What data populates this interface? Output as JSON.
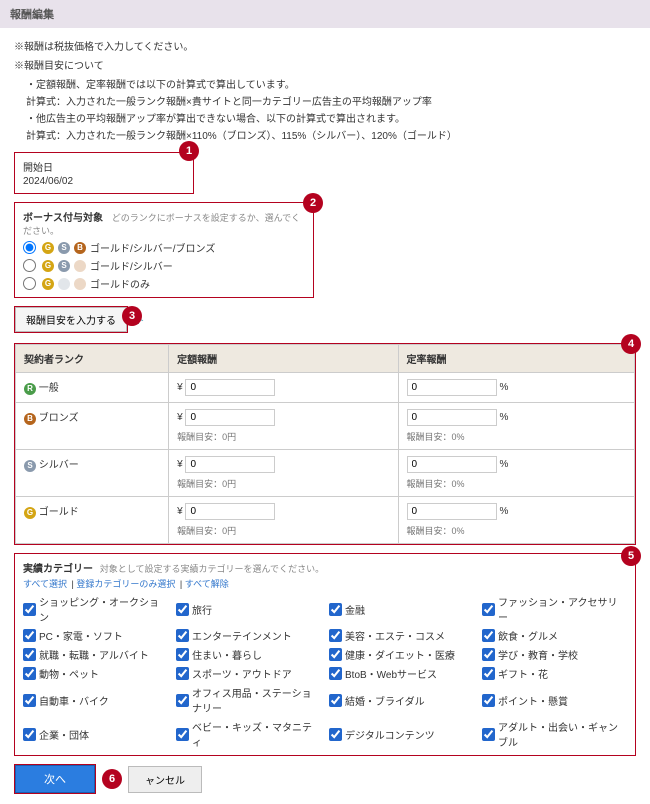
{
  "header": {
    "title": "報酬編集"
  },
  "intro": {
    "line1": "※報酬は税抜価格で入力してください。",
    "line2": "※報酬目安について",
    "bullets": [
      "・定額報酬、定率報酬では以下の計算式で算出しています。",
      "計算式：入力された一般ランク報酬×貴サイトと同一カテゴリー広告主の平均報酬アップ率",
      "・他広告主の平均報酬アップ率が算出できない場合、以下の計算式で算出されます。",
      "計算式：入力された一般ランク報酬×110%（ブロンズ）、115%（シルバー）、120%（ゴールド）"
    ]
  },
  "startDate": {
    "label": "開始日",
    "value": "2024/06/02"
  },
  "bonus": {
    "title": "ボーナス付与対象",
    "hint": "どのランクにボーナスを設定するか、選んでください。",
    "options": [
      {
        "label": "ゴールド/シルバー/ブロンズ"
      },
      {
        "label": "ゴールド/シルバー"
      },
      {
        "label": "ゴールドのみ"
      }
    ]
  },
  "inputBtn": {
    "label": "報酬目安を入力する",
    "trail": "ト"
  },
  "table": {
    "headers": {
      "c1": "契約者ランク",
      "c2": "定額報酬",
      "c3": "定率報酬"
    },
    "rows": [
      {
        "rank": "一般",
        "fixedPrefix": "¥",
        "fixedVal": "0",
        "fixedSub": "",
        "ratePrefix": "",
        "rateVal": "0",
        "rateUnit": "%",
        "rateSub": ""
      },
      {
        "rank": "ブロンズ",
        "fixedPrefix": "¥",
        "fixedVal": "0",
        "fixedSub": "報酬目安：0円",
        "ratePrefix": "",
        "rateVal": "0",
        "rateUnit": "%",
        "rateSub": "報酬目安：0%"
      },
      {
        "rank": "シルバー",
        "fixedPrefix": "¥",
        "fixedVal": "0",
        "fixedSub": "報酬目安：0円",
        "ratePrefix": "",
        "rateVal": "0",
        "rateUnit": "%",
        "rateSub": "報酬目安：0%"
      },
      {
        "rank": "ゴールド",
        "fixedPrefix": "¥",
        "fixedVal": "0",
        "fixedSub": "報酬目安：0円",
        "ratePrefix": "",
        "rateVal": "0",
        "rateUnit": "%",
        "rateSub": "報酬目安：0%"
      }
    ]
  },
  "categories": {
    "title": "実績カテゴリー",
    "hint": "対象として設定する実績カテゴリーを選んでください。",
    "links": {
      "all": "すべて選択",
      "sep1": " | ",
      "reg": "登録カテゴリーのみ選択",
      "sep2": " | ",
      "none": "すべて解除"
    },
    "items": [
      "ショッピング・オークション",
      "旅行",
      "金融",
      "ファッション・アクセサリー",
      "PC・家電・ソフト",
      "エンターテインメント",
      "美容・エステ・コスメ",
      "飲食・グルメ",
      "就職・転職・アルバイト",
      "住まい・暮らし",
      "健康・ダイエット・医療",
      "学び・教育・学校",
      "動物・ペット",
      "スポーツ・アウトドア",
      "BtoB・Webサービス",
      "ギフト・花",
      "自動車・バイク",
      "オフィス用品・ステーショナリー",
      "結婚・ブライダル",
      "ポイント・懸賞",
      "企業・団体",
      "ベビー・キッズ・マタニティ",
      "デジタルコンテンツ",
      "アダルト・出会い・ギャンブル"
    ]
  },
  "footer": {
    "next": "次へ",
    "cancel": "ャンセル"
  },
  "badges": {
    "b1": "1",
    "b2": "2",
    "b3": "3",
    "b4": "4",
    "b5": "5",
    "b6": "6"
  }
}
